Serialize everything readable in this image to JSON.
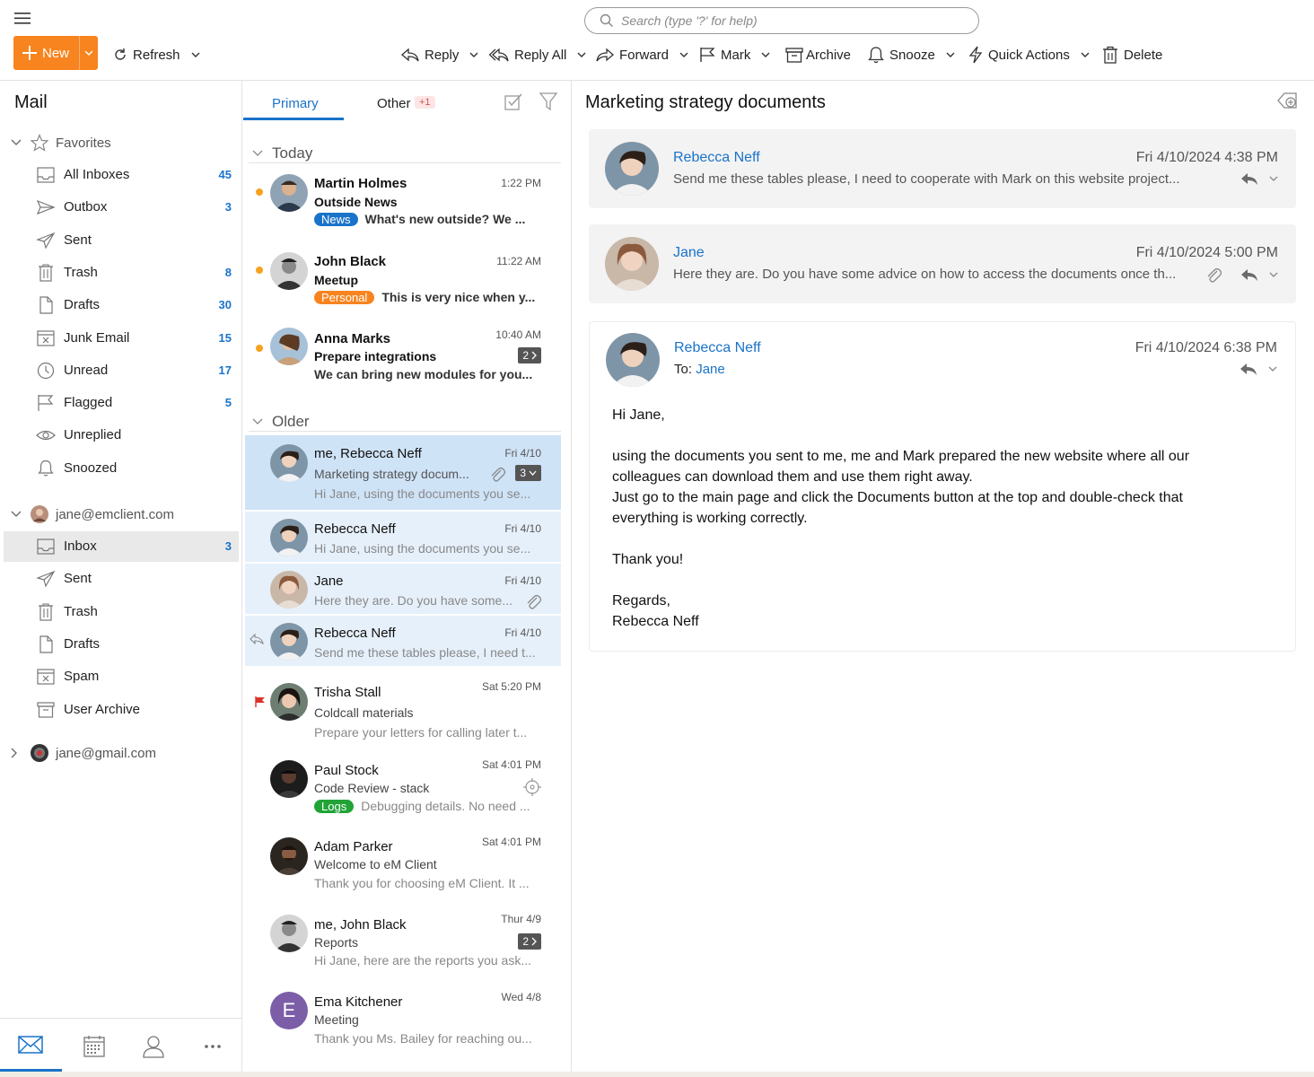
{
  "toolbar": {
    "search_placeholder": "Search (type '?' for help)",
    "new_label": "New",
    "refresh_label": "Refresh",
    "reply_label": "Reply",
    "reply_all_label": "Reply All",
    "forward_label": "Forward",
    "mark_label": "Mark",
    "archive_label": "Archive",
    "snooze_label": "Snooze",
    "quick_actions_label": "Quick Actions",
    "delete_label": "Delete"
  },
  "sidebar": {
    "title": "Mail",
    "favorites_label": "Favorites",
    "favorites": [
      {
        "label": "All Inboxes",
        "count": "45",
        "icon": "inbox-icon"
      },
      {
        "label": "Outbox",
        "count": "3",
        "icon": "outbox-icon"
      },
      {
        "label": "Sent",
        "count": "",
        "icon": "sent-icon"
      },
      {
        "label": "Trash",
        "count": "8",
        "icon": "trash-icon"
      },
      {
        "label": "Drafts",
        "count": "30",
        "icon": "drafts-icon"
      },
      {
        "label": "Junk Email",
        "count": "15",
        "icon": "junk-icon"
      },
      {
        "label": "Unread",
        "count": "17",
        "icon": "clock-icon"
      },
      {
        "label": "Flagged",
        "count": "5",
        "icon": "flag-icon"
      },
      {
        "label": "Unreplied",
        "count": "",
        "icon": "eye-icon"
      },
      {
        "label": "Snoozed",
        "count": "",
        "icon": "snooze-icon"
      }
    ],
    "account1": "jane@emclient.com",
    "account1_folders": [
      {
        "label": "Inbox",
        "count": "3",
        "icon": "inbox-icon"
      },
      {
        "label": "Sent",
        "count": "",
        "icon": "sent-icon"
      },
      {
        "label": "Trash",
        "count": "",
        "icon": "trash-icon"
      },
      {
        "label": "Drafts",
        "count": "",
        "icon": "drafts-icon"
      },
      {
        "label": "Spam",
        "count": "",
        "icon": "junk-icon"
      },
      {
        "label": "User Archive",
        "count": "",
        "icon": "archive-icon"
      }
    ],
    "account2": "jane@gmail.com"
  },
  "list": {
    "tab_primary": "Primary",
    "tab_other": "Other",
    "tab_other_badge": "+1",
    "section_today": "Today",
    "section_older": "Older",
    "today": [
      {
        "from": "Martin Holmes",
        "time": "1:22 PM",
        "subject": "Outside News",
        "tag": "News",
        "tag_color": "#1a73c9",
        "preview": "What's new outside? We ..."
      },
      {
        "from": "John Black",
        "time": "11:22 AM",
        "subject": "Meetup",
        "tag": "Personal",
        "tag_color": "#f7841f",
        "preview": "This is very nice when y..."
      },
      {
        "from": "Anna Marks",
        "time": "10:40 AM",
        "subject": "Prepare integrations",
        "count": "2",
        "preview": "We can bring new modules for you..."
      }
    ],
    "older": [
      {
        "from": "me, Rebecca Neff",
        "time": "Fri 4/10",
        "subject": "Marketing strategy docum...",
        "count": "3",
        "preview": "Hi Jane, using the documents you se..."
      },
      {
        "from": "Rebecca Neff",
        "time": "Fri 4/10",
        "preview": "Hi Jane, using the documents you se..."
      },
      {
        "from": "Jane",
        "time": "Fri 4/10",
        "preview": "Here they are. Do you have some..."
      },
      {
        "from": "Rebecca Neff",
        "time": "Fri 4/10",
        "preview": "Send me these tables please, I need t..."
      },
      {
        "from": "Trisha Stall",
        "time": "Sat 5:20 PM",
        "subject": "Coldcall materials",
        "preview": "Prepare your letters for calling later t..."
      },
      {
        "from": "Paul Stock",
        "time": "Sat 4:01 PM",
        "subject": "Code Review - stack",
        "tag": "Logs",
        "tag_color": "#21a336",
        "preview": "Debugging details. No need ..."
      },
      {
        "from": "Adam Parker",
        "time": "Sat 4:01 PM",
        "subject": "Welcome to eM Client",
        "preview": "Thank you for choosing eM Client. It ..."
      },
      {
        "from": "me, John Black",
        "time": "Thur 4/9",
        "subject": "Reports",
        "count": "2",
        "preview": "Hi Jane, here are the reports you ask..."
      },
      {
        "from": "Ema Kitchener",
        "time": "Wed 4/8",
        "subject": "Meeting",
        "initial": "E",
        "preview": "Thank you Ms. Bailey for reaching ou..."
      }
    ]
  },
  "reader": {
    "title": "Marketing strategy documents",
    "messages": [
      {
        "from": "Rebecca Neff",
        "date": "Fri 4/10/2024 4:38 PM",
        "snippet": "Send me these tables please, I need to cooperate with Mark on this website project..."
      },
      {
        "from": "Jane",
        "date": "Fri 4/10/2024 5:00 PM",
        "snippet": "Here they are. Do you have some advice on how to access the documents once th..."
      },
      {
        "from": "Rebecca Neff",
        "date": "Fri 4/10/2024 6:38 PM",
        "to_label": "To:",
        "to": "Jane"
      }
    ],
    "body": {
      "greeting": "Hi Jane,",
      "p1_line1": "using the documents you sent to me, me and Mark prepared the new website where all our",
      "p1_line2": "colleagues can download them and use them right away.",
      "p1_line3": "Just go to the main page and click the Documents button at the top and double-check that",
      "p1_line4": "everything is working correctly.",
      "thanks": "Thank you!",
      "regards": "Regards,",
      "signature": "Rebecca Neff"
    }
  },
  "colors": {
    "accent": "#1a73c9",
    "new_button": "#f7841f",
    "unread_dot": "#f7a21f",
    "selected": "#cfe3f7"
  }
}
